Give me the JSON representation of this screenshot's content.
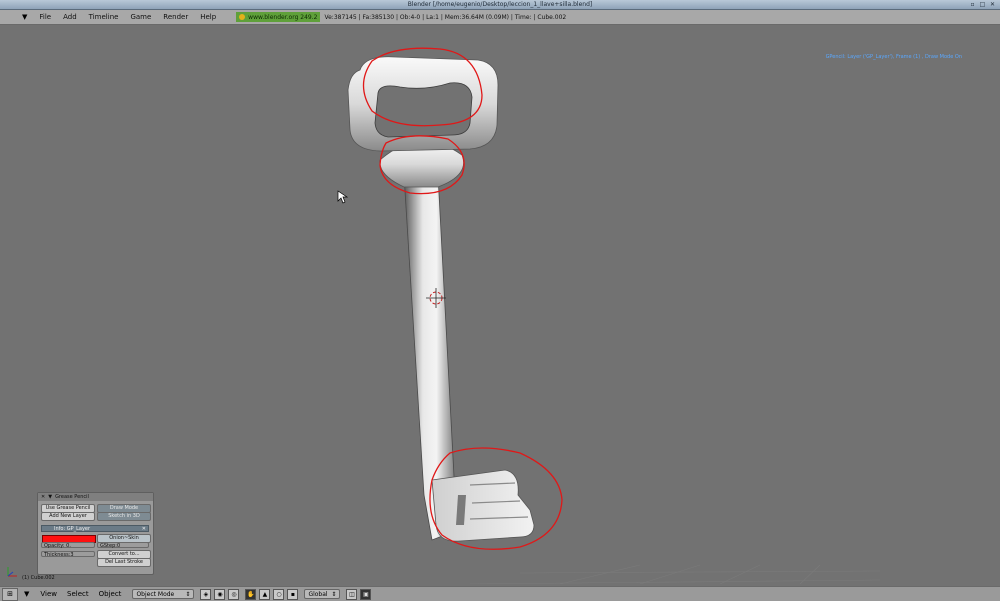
{
  "window": {
    "title": "Blender [/home/eugenio/Desktop/leccion_1_llave+silla.blend]",
    "controls": [
      "▫",
      "□",
      "✕"
    ]
  },
  "top_menu": {
    "chevron": "▼",
    "items": [
      "File",
      "Add",
      "Timeline",
      "Game",
      "Render",
      "Help"
    ],
    "site_label": "www.blender.org 249.2",
    "stats": "Ve:387145 | Fa:385130 | Ob:4-0 | La:1 | Mem:36.64M (0.09M) | Time: | Cube.002"
  },
  "viewport": {
    "overlay_text": "GPencil: Layer ('GP_Layer'), Frame (1) , Draw Mode On",
    "annotation_color": "#e01818",
    "background_color": "#727272"
  },
  "grease_pencil": {
    "header_close": "✕",
    "header_arrow": "▼",
    "title": "Grease Pencil",
    "use_button": "Use Grease Pencil",
    "draw_mode": "Draw Mode",
    "add_layer": "Add New Layer",
    "sketch_3d": "Sketch in 3D",
    "layer_name": "Info: GP_Layer",
    "layer_close": "✕",
    "stroke_color": "#ff1010",
    "onion_skin": "Onion~Skin",
    "opacity": "Opacity: 0.",
    "gstep": "GStep:0",
    "thickness": "Thickness:3",
    "convert": "Convert to...",
    "del_stroke": "Del Last Stroke"
  },
  "status": {
    "object_label": "(1) Cube.002"
  },
  "bottom_bar": {
    "editor_icon": "⊞",
    "chevron": "▼",
    "menus": [
      "View",
      "Select",
      "Object"
    ],
    "mode": "Object Mode",
    "mode_arrow": "⇕",
    "orientation": "Global",
    "orientation_arrow": "⇕"
  }
}
